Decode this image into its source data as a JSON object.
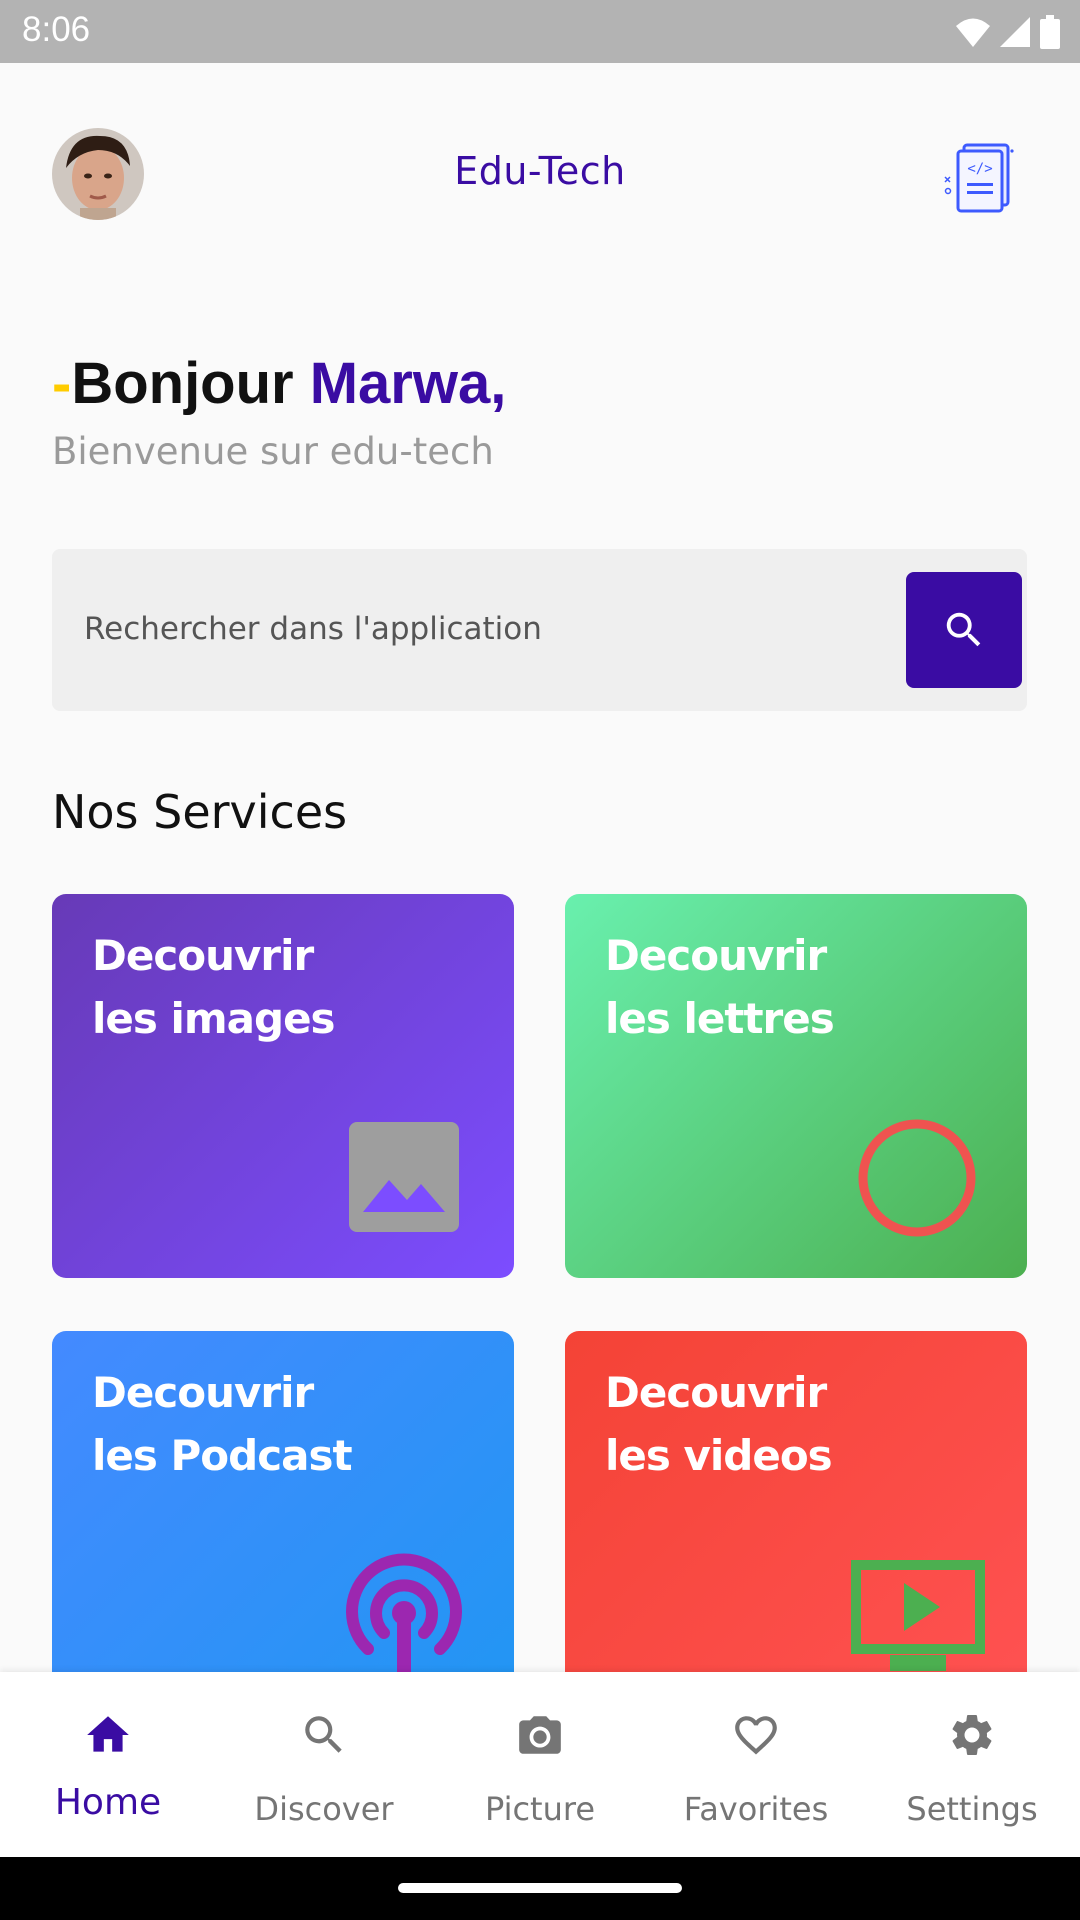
{
  "status": {
    "time": "8:06"
  },
  "header": {
    "title": "Edu-Tech"
  },
  "greeting": {
    "dash": "-",
    "hello": "Bonjour ",
    "name": "Marwa,",
    "subtitle": "Bienvenue sur edu-tech"
  },
  "search": {
    "placeholder": "Rechercher dans l'application"
  },
  "services": {
    "title": "Nos Services",
    "cards": [
      {
        "line1": "Decouvrir",
        "line2": "les images",
        "icon": "image-icon"
      },
      {
        "line1": "Decouvrir",
        "line2": "les lettres",
        "icon": "circle-icon"
      },
      {
        "line1": "Decouvrir",
        "line2": "les Podcast",
        "icon": "podcast-icon"
      },
      {
        "line1": "Decouvrir",
        "line2": "les videos",
        "icon": "video-icon"
      }
    ]
  },
  "nav": {
    "items": [
      {
        "label": "Home",
        "icon": "home-icon",
        "active": true
      },
      {
        "label": "Discover",
        "icon": "search-icon"
      },
      {
        "label": "Picture",
        "icon": "camera-icon"
      },
      {
        "label": "Favorites",
        "icon": "heart-icon"
      },
      {
        "label": "Settings",
        "icon": "gear-icon"
      }
    ]
  },
  "colors": {
    "primary": "#3a0ca3",
    "accent_dash": "#ffcc00"
  }
}
